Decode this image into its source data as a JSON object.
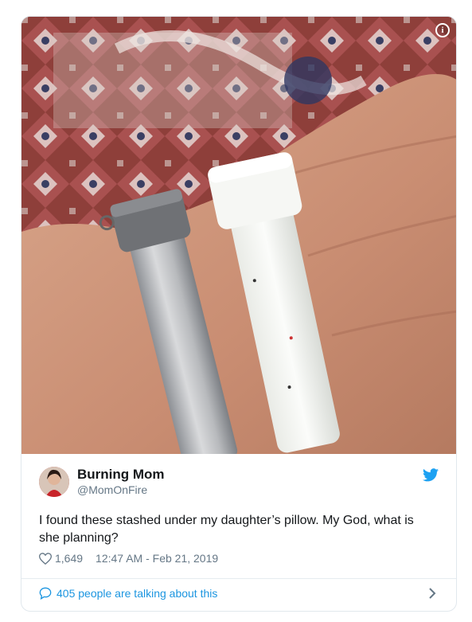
{
  "tweet": {
    "display_name": "Burning Mom",
    "handle": "@MomOnFire",
    "text": "I found these stashed under my daughter’s pillow. My God, what is she planning?",
    "likes": "1,649",
    "timestamp": "12:47 AM - Feb 21, 2019",
    "talking": "405 people are talking about this"
  },
  "icons": {
    "info": "info-icon",
    "brand": "twitter-bird-icon",
    "like": "heart-icon",
    "reply": "speech-bubble-icon",
    "more": "chevron-right-icon"
  },
  "colors": {
    "twitter_blue": "#1da1f2",
    "link_blue": "#1b95e0",
    "text": "#14171a",
    "muted": "#657786",
    "border": "#e1e8ed"
  }
}
